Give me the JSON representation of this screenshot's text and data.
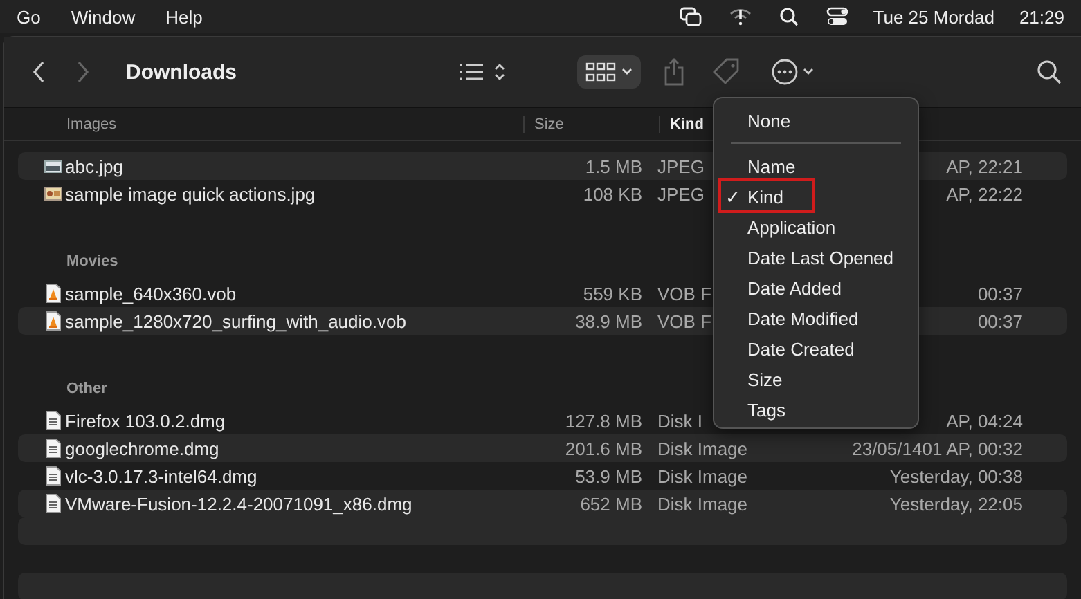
{
  "menu_bar": {
    "menus": [
      "Go",
      "Window",
      "Help"
    ],
    "date": "Tue 25 Mordad",
    "time": "21:29"
  },
  "toolbar": {
    "title": "Downloads"
  },
  "columns": {
    "size": "Size",
    "kind": "Kind"
  },
  "groups": [
    {
      "title": "Images",
      "items": [
        {
          "name": "abc.jpg",
          "kind": "image",
          "size": "1.5 MB",
          "type": "JPEG",
          "date": "AP, 22:21"
        },
        {
          "name": "sample image quick actions.jpg",
          "kind": "photo",
          "size": "108 KB",
          "type": "JPEG",
          "date": "AP, 22:22"
        }
      ]
    },
    {
      "title": "Movies",
      "items": [
        {
          "name": "sample_640x360.vob",
          "kind": "video",
          "size": "559 KB",
          "type": "VOB F",
          "date": "00:37"
        },
        {
          "name": "sample_1280x720_surfing_with_audio.vob",
          "kind": "video",
          "size": "38.9 MB",
          "type": "VOB F",
          "date": "00:37"
        }
      ]
    },
    {
      "title": "Other",
      "items": [
        {
          "name": "Firefox 103.0.2.dmg",
          "kind": "disk",
          "size": "127.8 MB",
          "type": "Disk I",
          "date": "AP, 04:24"
        },
        {
          "name": "googlechrome.dmg",
          "kind": "disk",
          "size": "201.6 MB",
          "type": "Disk Image",
          "date": "23/05/1401 AP, 00:32"
        },
        {
          "name": "vlc-3.0.17.3-intel64.dmg",
          "kind": "disk",
          "size": "53.9 MB",
          "type": "Disk Image",
          "date": "Yesterday, 00:38"
        },
        {
          "name": "VMware-Fusion-12.2.4-20071091_x86.dmg",
          "kind": "disk",
          "size": "652 MB",
          "type": "Disk Image",
          "date": "Yesterday, 22:05"
        }
      ]
    }
  ],
  "group_menu": {
    "check_mark": "✓",
    "sections": [
      [
        {
          "label": "None",
          "checked": false,
          "highlighted": false
        }
      ],
      [
        {
          "label": "Name",
          "checked": false,
          "highlighted": false
        },
        {
          "label": "Kind",
          "checked": true,
          "highlighted": true
        },
        {
          "label": "Application",
          "checked": false,
          "highlighted": false
        },
        {
          "label": "Date Last Opened",
          "checked": false,
          "highlighted": false
        },
        {
          "label": "Date Added",
          "checked": false,
          "highlighted": false
        },
        {
          "label": "Date Modified",
          "checked": false,
          "highlighted": false
        },
        {
          "label": "Date Created",
          "checked": false,
          "highlighted": false
        },
        {
          "label": "Size",
          "checked": false,
          "highlighted": false
        },
        {
          "label": "Tags",
          "checked": false,
          "highlighted": false
        }
      ]
    ]
  }
}
